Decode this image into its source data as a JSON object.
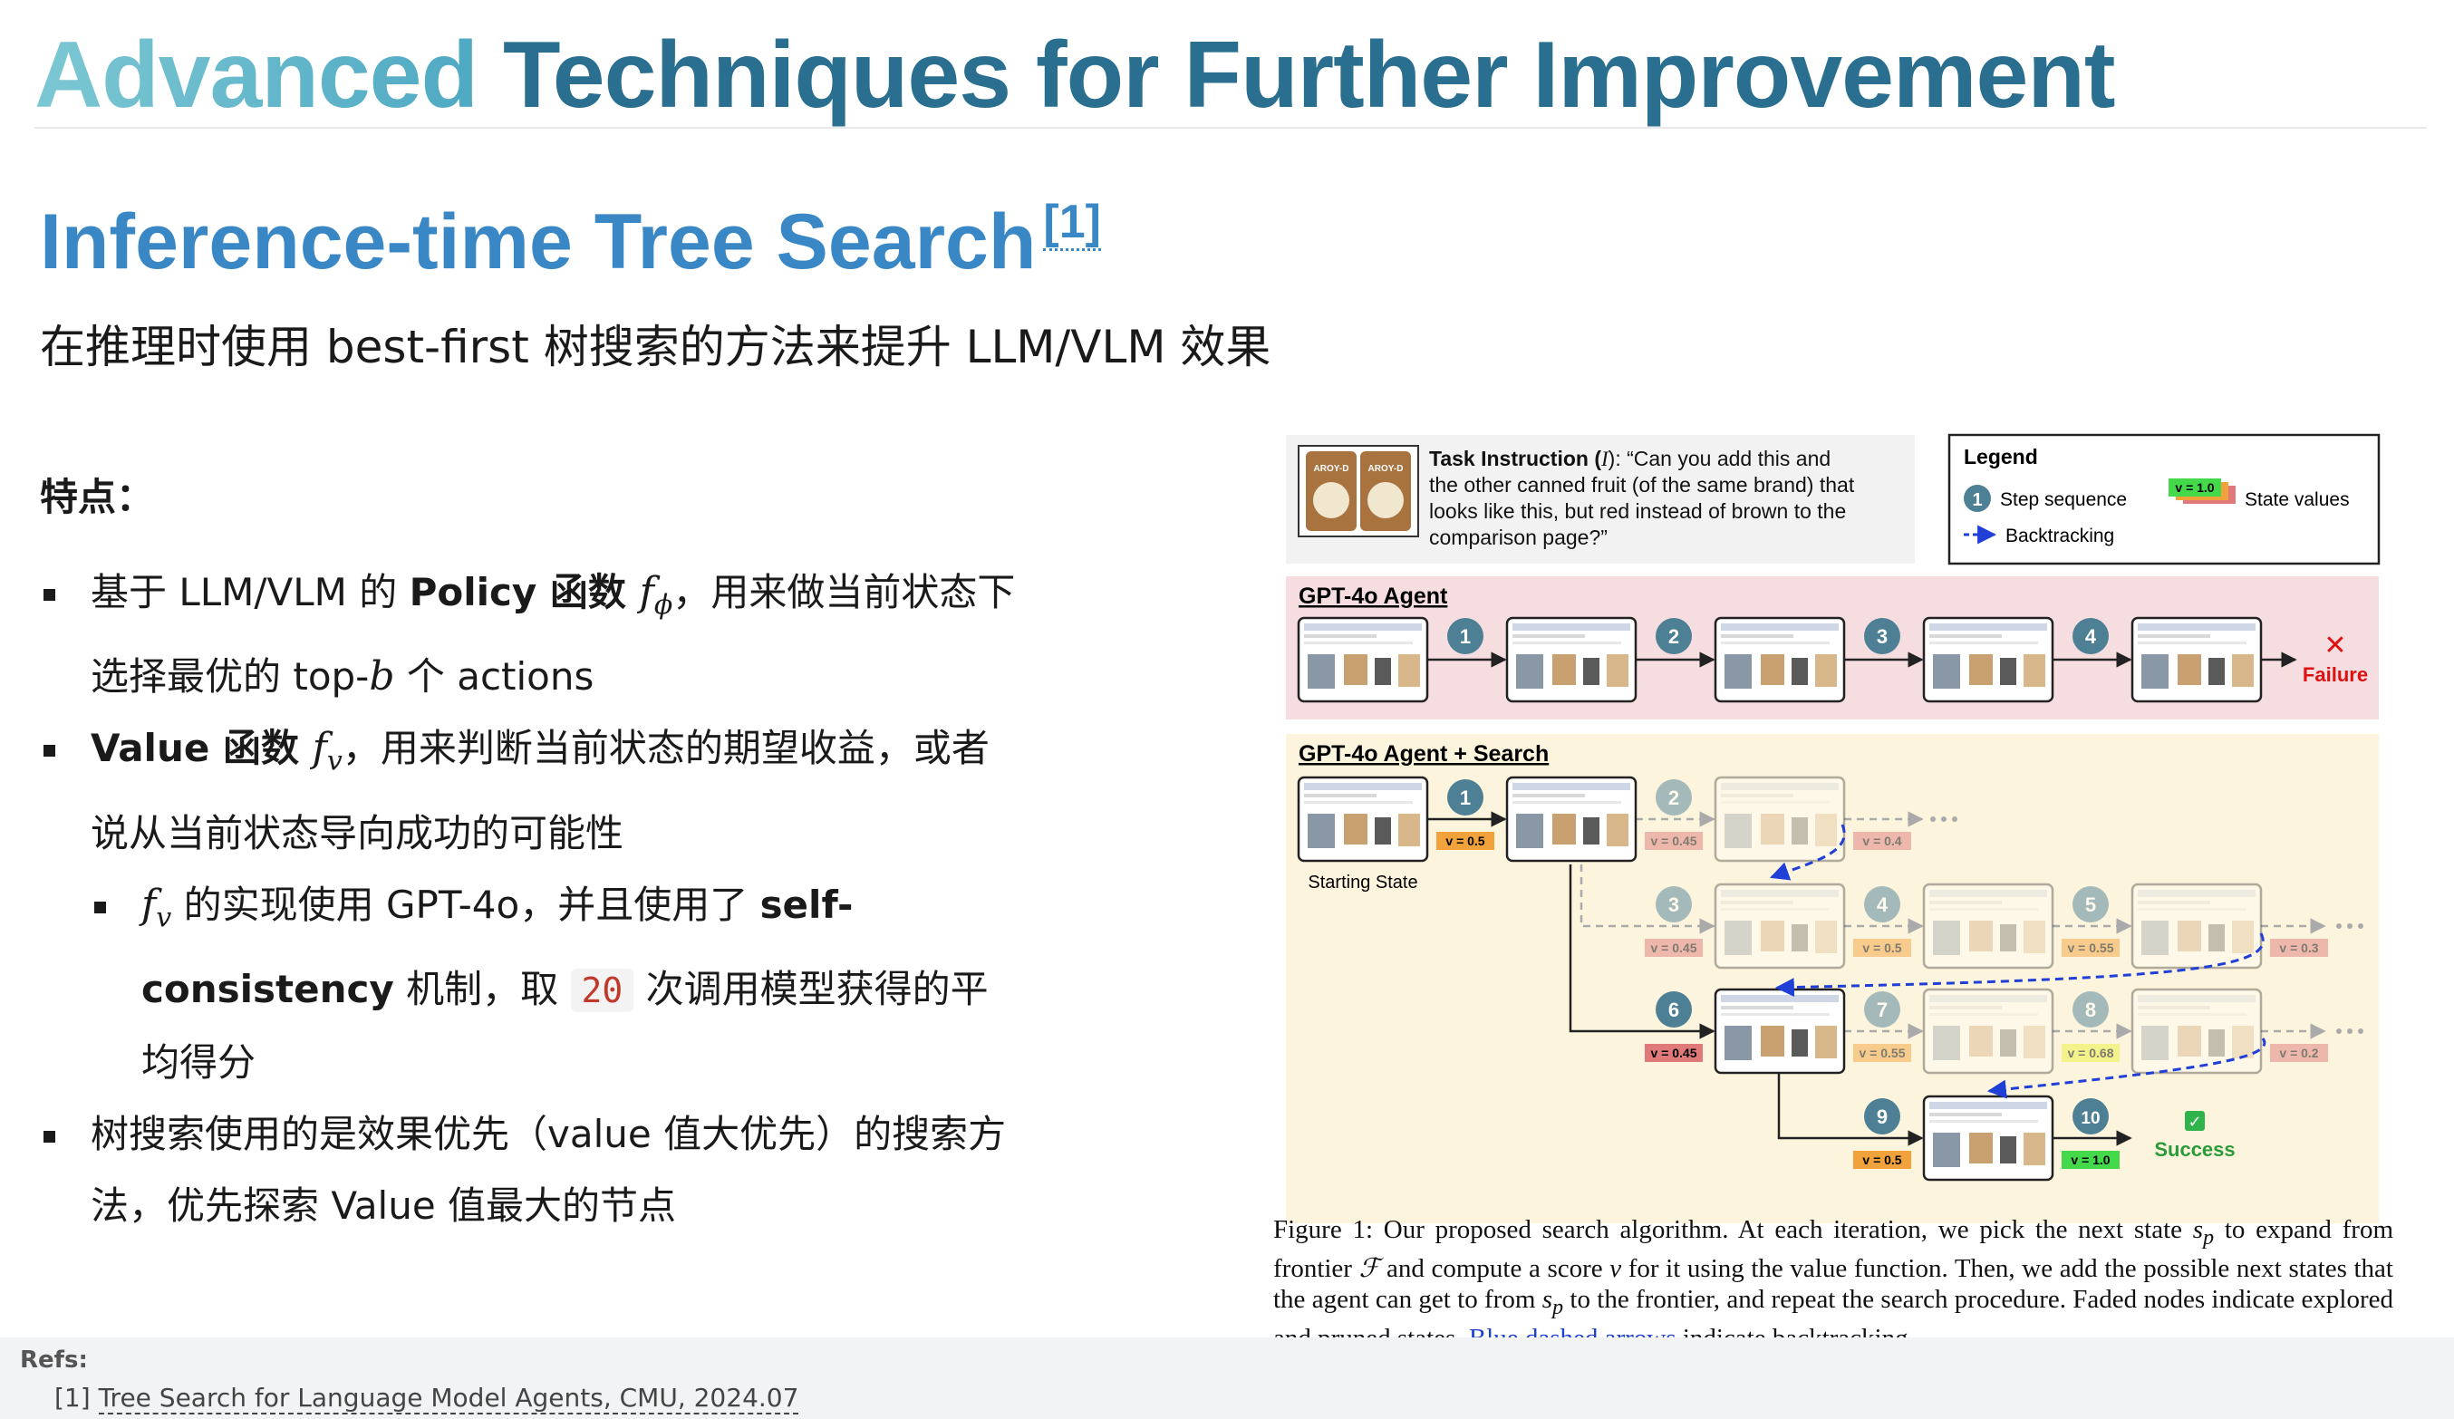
{
  "title": {
    "part1": "Advanced",
    "part2": " Techniques for Further Improvement"
  },
  "subtitle": {
    "text": "Inference-time Tree Search",
    "ref": "[1]"
  },
  "lead": "在推理时使用 best-first 树搜索的方法来提升 LLM/VLM 效果",
  "features_label": "特点：",
  "bullets": {
    "b1": {
      "pre": "基于 LLM/VLM 的 ",
      "bold": "Policy 函数 ",
      "math": "f",
      "mathsub": "ϕ",
      "post": "，用来做当前状态下选择最优的 top-",
      "math2": "b",
      "post2": " 个 actions"
    },
    "b2": {
      "bold": "Value 函数 ",
      "math": "f",
      "mathsub": "v",
      "post": "，用来判断当前状态的期望收益，或者说从当前状态导向成功的可能性"
    },
    "b2sub": {
      "math": "f",
      "mathsub": "v",
      "pre": " 的实现使用 GPT-4o，并且使用了 ",
      "bold": "self-consistency",
      "mid": " 机制，取 ",
      "code": "20",
      "post": " 次调用模型获得的平均得分"
    },
    "b3": "树搜索使用的是效果优先（value 值大优先）的搜索方法，优先探索 Value 值最大的节点"
  },
  "figure": {
    "task_label": "Task Instruction (",
    "task_i": "I",
    "task_text1": "): “Can you add this and",
    "task_text2": "the other canned fruit (of the same brand) that",
    "task_text3": "looks like this, but red instead of brown to the",
    "task_text4": "comparison page?”",
    "can_label": "AROY-D",
    "legend_title": "Legend",
    "legend_step": "Step sequence",
    "legend_state": "State values",
    "legend_badge": "v = 1.0",
    "legend_back": "Backtracking",
    "gpt_label": "GPT-4o Agent",
    "failure": "Failure",
    "search_label": "GPT-4o Agent + Search",
    "starting_state": "Starting State",
    "success": "Success",
    "steps": [
      "1",
      "2",
      "3",
      "4",
      "5",
      "6",
      "7",
      "8",
      "9",
      "10"
    ],
    "values": {
      "v1": "v = 0.5",
      "v2a": "v = 0.45",
      "v2b": "v = 0.4",
      "v3": "v = 0.45",
      "v4": "v = 0.5",
      "v5": "v = 0.55",
      "v5b": "v = 0.3",
      "v6": "v = 0.45",
      "v7": "v = 0.55",
      "v8": "v = 0.68",
      "v8b": "v = 0.2",
      "v9": "v = 0.5",
      "v10": "v = 1.0"
    },
    "colors": {
      "agent_bg": "#f6dde0",
      "search_bg": "#fdf4dd",
      "step": "#4d7f95",
      "red_badge": "#e07a7a",
      "orange_badge": "#f2a23a",
      "yellow_badge": "#ecef3a",
      "green_badge": "#43d94a",
      "blue": "#1f3fd6"
    }
  },
  "caption": {
    "text1": "Figure 1:  Our proposed search algorithm.  At each iteration, we pick the next state ",
    "sp1": "s",
    "sp1sub": "p",
    "text2": " to expand from frontier ",
    "F": "ℱ",
    "text3": " and compute a score ",
    "v": "v",
    "text4": " for it using the value function.  Then, we add the possible next states that the agent can get to from ",
    "sp2": "s",
    "sp2sub": "p",
    "text5": " to the frontier, and repeat the search procedure.  Faded nodes indicate explored and pruned states. ",
    "blue": "Blue dashed arrows",
    "text6": " indicate backtracking."
  },
  "refs": {
    "label": "Refs:",
    "num": "[1] ",
    "link": "Tree Search for Language Model Agents, CMU, 2024.07"
  }
}
